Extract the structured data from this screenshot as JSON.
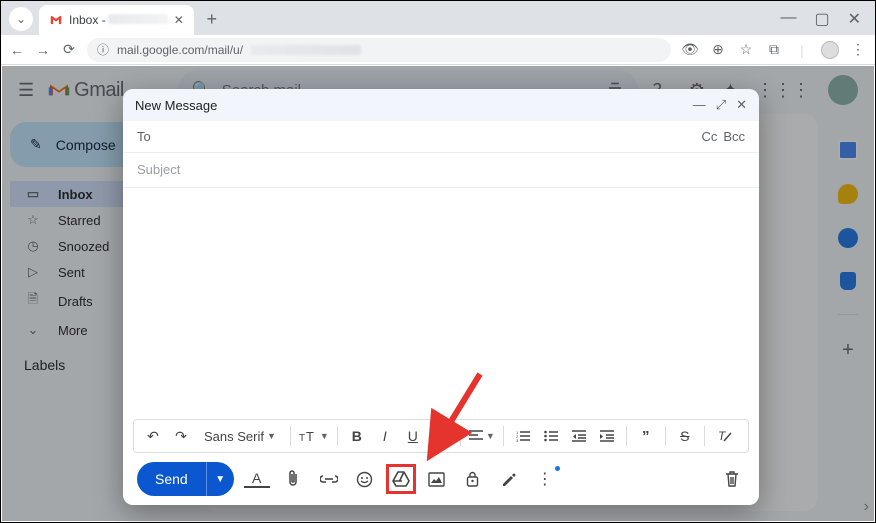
{
  "browser": {
    "tab_title": "Inbox -",
    "url": "mail.google.com/mail/u/"
  },
  "header": {
    "product": "Gmail",
    "search_placeholder": "Search mail"
  },
  "sidebar": {
    "compose": "Compose",
    "items": [
      {
        "label": "Inbox"
      },
      {
        "label": "Starred"
      },
      {
        "label": "Snoozed"
      },
      {
        "label": "Sent"
      },
      {
        "label": "Drafts"
      },
      {
        "label": "More"
      }
    ],
    "labels_header": "Labels"
  },
  "compose": {
    "title": "New Message",
    "to_label": "To",
    "cc": "Cc",
    "bcc": "Bcc",
    "subject_placeholder": "Subject",
    "font_family": "Sans Serif",
    "send": "Send"
  }
}
